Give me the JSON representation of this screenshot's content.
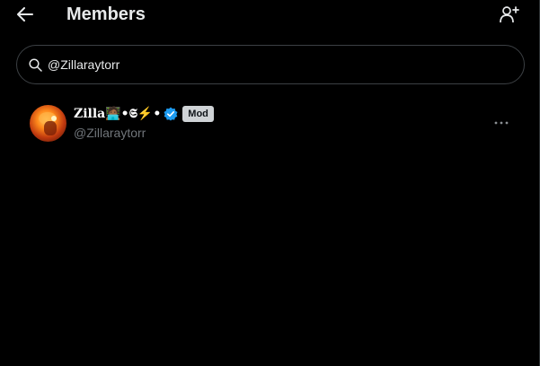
{
  "header": {
    "title": "Members",
    "back_icon": "arrow-left-icon",
    "add_member_icon": "add-user-icon"
  },
  "search": {
    "icon": "search-icon",
    "value": "@Zillaraytorr",
    "placeholder": ""
  },
  "members": [
    {
      "display_name": "Zilla🧑🏾‍💻•𝕾⚡•",
      "handle": "@Zillaraytorr",
      "verified": true,
      "badge": "Mod",
      "more_icon": "more-horizontal-icon"
    }
  ],
  "colors": {
    "background": "#000000",
    "text": "#e7e9ea",
    "muted": "#71767b",
    "verified": "#1d9bf0",
    "badge_bg": "#cfd3d6"
  }
}
